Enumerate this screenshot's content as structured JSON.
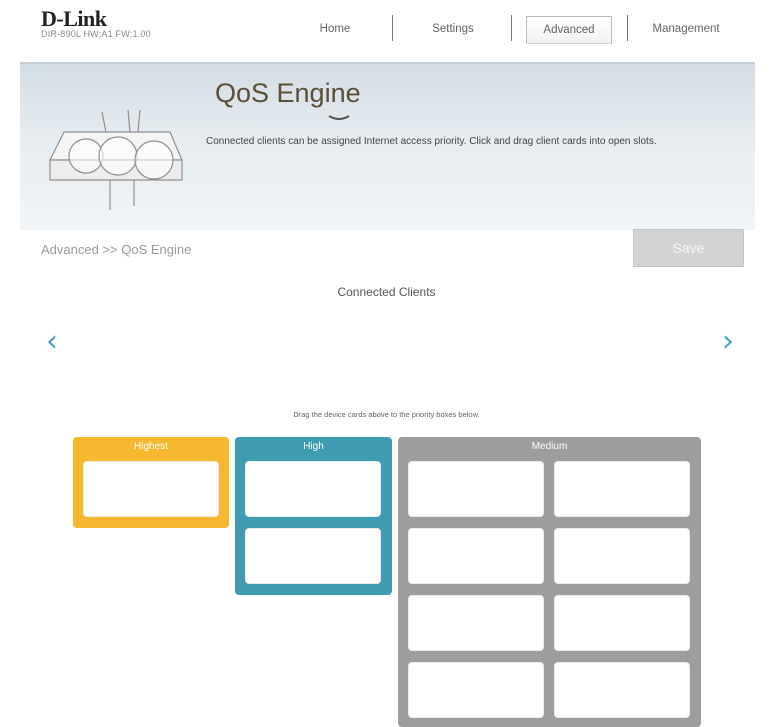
{
  "header": {
    "logo": "D-Link",
    "model_info": "DIR-890L   HW:A1   FW:1.00",
    "nav": [
      {
        "label": "Home"
      },
      {
        "label": "Settings"
      },
      {
        "label": "Advanced",
        "active": true
      },
      {
        "label": "Management"
      }
    ]
  },
  "banner": {
    "title": "QoS Engine",
    "description": "Connected clients can be assigned Internet access priority. Click and drag client cards into open slots."
  },
  "breadcrumb": "Advanced >> QoS Engine",
  "save_label": "Save",
  "connected_clients_label": "Connected Clients",
  "prev_arrow": "‹",
  "next_arrow": "›",
  "drag_hint": "Drag the device cards above to the priority boxes below.",
  "priority_boxes": [
    {
      "label": "Highest",
      "color": "#f5b82e",
      "slots": 1
    },
    {
      "label": "High",
      "color": "#3e9bb0",
      "slots": 2
    },
    {
      "label": "Medium",
      "color": "#9d9d9d",
      "slots": 8
    }
  ],
  "colors": {
    "accent": "#4aa3c2",
    "highest": "#f5b82e",
    "high": "#3e9bb0",
    "medium": "#9d9d9d"
  }
}
